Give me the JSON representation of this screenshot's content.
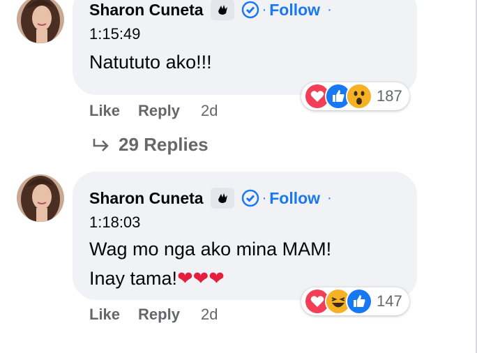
{
  "comments": [
    {
      "author": "Sharon Cuneta",
      "follow_label": "Follow",
      "dot": "·",
      "timestamp": "1:15:49",
      "text": "Natututo ako!!!",
      "reactions": [
        "love-icon",
        "like-icon",
        "wow-icon"
      ],
      "reaction_count": "187",
      "actions": {
        "like": "Like",
        "reply": "Reply",
        "age": "2d"
      },
      "replies_label": "29 Replies"
    },
    {
      "author": "Sharon Cuneta",
      "follow_label": "Follow",
      "dot": "·",
      "timestamp": "1:18:03",
      "text_line1": "Wag mo nga ako mina MAM!",
      "text_line2": "Inay tama!",
      "hearts": "❤❤❤",
      "reactions": [
        "love-icon",
        "haha-icon",
        "like-icon"
      ],
      "reaction_count": "147",
      "actions": {
        "like": "Like",
        "reply": "Reply",
        "age": "2d"
      }
    }
  ],
  "colors": {
    "bubble": "#f0f2f5",
    "link_blue": "#1877f2",
    "secondary_text": "#65676b",
    "love_red": "#f33e58",
    "haha_yellow": "#f7b125"
  }
}
